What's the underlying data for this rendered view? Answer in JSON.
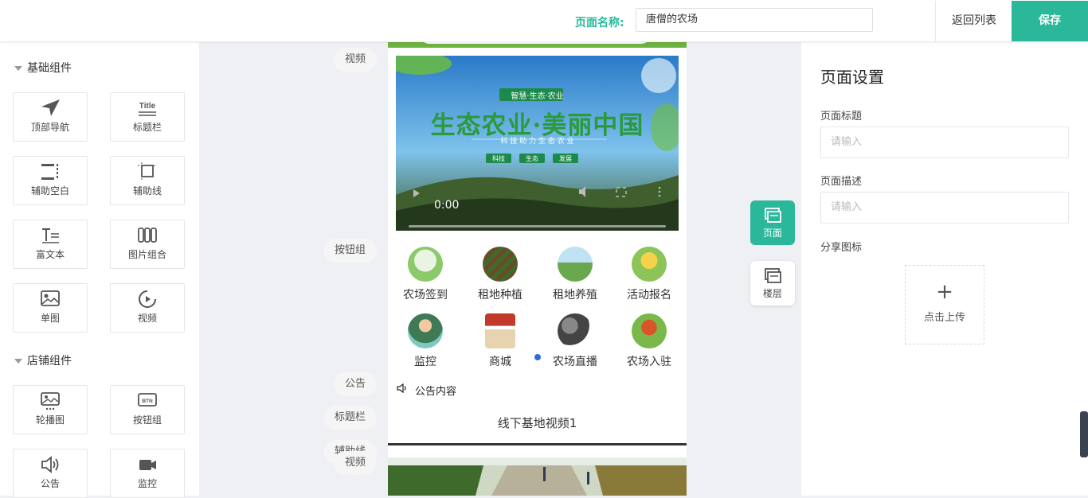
{
  "header": {
    "page_name_label": "页面名称:",
    "page_name_value": "唐僧的农场",
    "back_label": "返回列表",
    "save_label": "保存"
  },
  "left_panel": {
    "groups": [
      {
        "title": "基础组件",
        "items": [
          {
            "label": "顶部导航",
            "icon": "navigation-arrow-icon"
          },
          {
            "label": "标题栏",
            "icon": "title-icon",
            "icon_text": "Title"
          },
          {
            "label": "辅助空白",
            "icon": "blank-space-icon"
          },
          {
            "label": "辅助线",
            "icon": "guide-line-icon"
          },
          {
            "label": "富文本",
            "icon": "rich-text-icon"
          },
          {
            "label": "图片组合",
            "icon": "image-group-icon"
          },
          {
            "label": "单图",
            "icon": "single-image-icon"
          },
          {
            "label": "视频",
            "icon": "video-icon"
          }
        ]
      },
      {
        "title": "店铺组件",
        "items": [
          {
            "label": "轮播图",
            "icon": "carousel-icon"
          },
          {
            "label": "按钮组",
            "icon": "button-group-icon",
            "icon_text": "BTN"
          },
          {
            "label": "公告",
            "icon": "speaker-icon"
          },
          {
            "label": "监控",
            "icon": "camera-icon"
          }
        ]
      }
    ]
  },
  "canvas": {
    "section_labels": {
      "video": "视频",
      "button_group": "按钮组",
      "notice": "公告",
      "title_bar": "标题栏",
      "guide_line": "辅助线",
      "video_2": "视频"
    },
    "video": {
      "headline": "生态农业·美丽中国",
      "badge": "智慧·生态·农业",
      "subtitle": "科 技 助 力 生 态 农 业",
      "tags": [
        "科技",
        "生态",
        "发展"
      ],
      "time": "0:00"
    },
    "buttons": [
      "农场签到",
      "租地种植",
      "租地养殖",
      "活动报名",
      "监控",
      "商城",
      "农场直播",
      "农场入驻"
    ],
    "notice_content": "公告内容",
    "title_bar_text": "线下基地视频1"
  },
  "side_tabs": [
    {
      "label": "页面",
      "active": true
    },
    {
      "label": "楼层",
      "active": false
    }
  ],
  "right_panel": {
    "title": "页面设置",
    "page_title_label": "页面标题",
    "page_title_placeholder": "请输入",
    "page_desc_label": "页面描述",
    "page_desc_placeholder": "请输入",
    "share_icon_label": "分享图标",
    "upload_label": "点击上传"
  },
  "colors": {
    "accent": "#2bb89a",
    "brand_green": "#6db33f"
  }
}
